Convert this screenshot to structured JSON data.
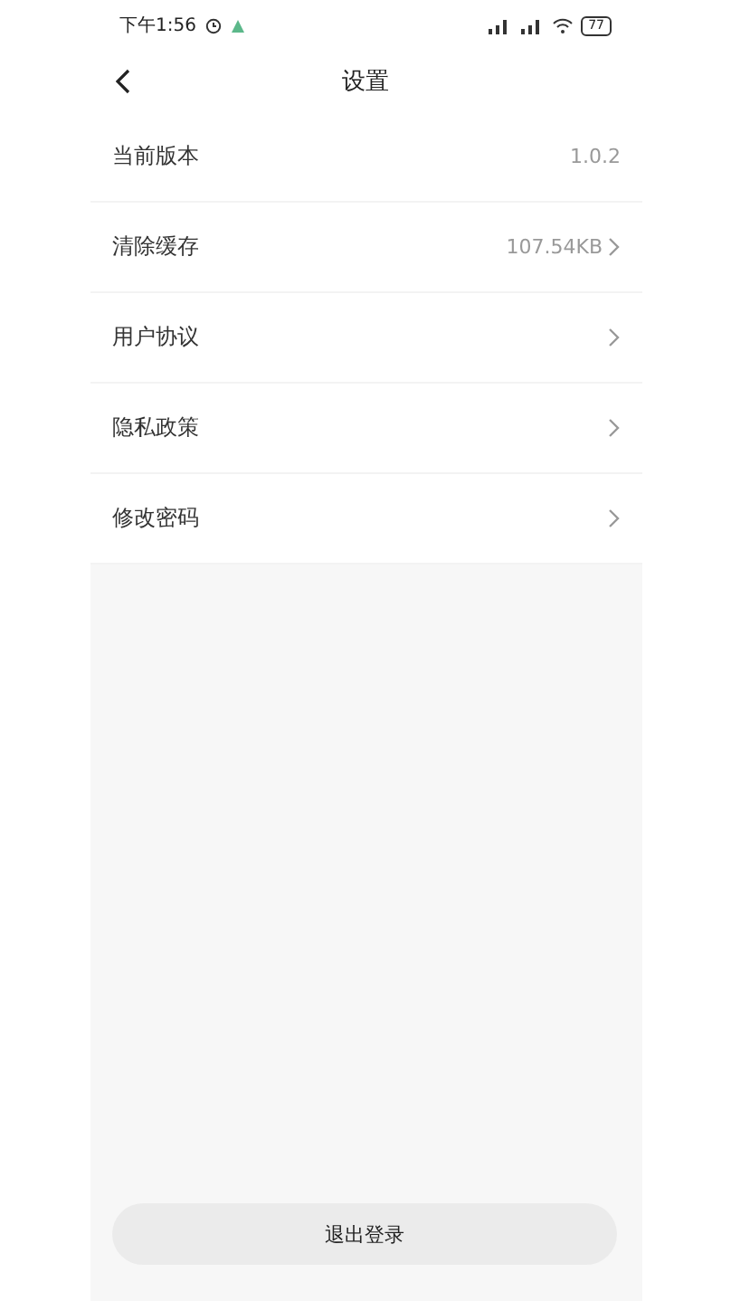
{
  "status_bar": {
    "time": "下午1:56",
    "battery": "77"
  },
  "header": {
    "title": "设置"
  },
  "rows": [
    {
      "label": "当前版本",
      "value": "1.0.2",
      "chevron": false
    },
    {
      "label": "清除缓存",
      "value": "107.54KB",
      "chevron": true
    },
    {
      "label": "用户协议",
      "chevron": true
    },
    {
      "label": "隐私政策",
      "chevron": true
    },
    {
      "label": "修改密码",
      "chevron": true
    }
  ],
  "logout_button": "退出登录"
}
